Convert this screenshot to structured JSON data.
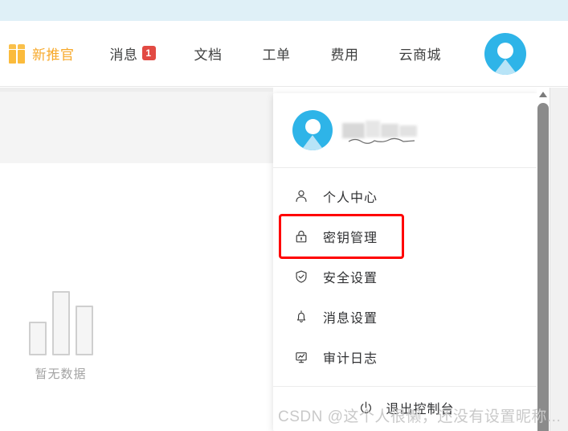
{
  "header": {
    "promo": {
      "icon": "gift-icon",
      "label": "新推官"
    },
    "nav_items": [
      {
        "label": "消息",
        "badge": "1",
        "icon": null
      },
      {
        "label": "文档",
        "badge": null,
        "icon": null
      },
      {
        "label": "工单",
        "badge": null,
        "icon": null
      },
      {
        "label": "费用",
        "badge": null,
        "icon": null
      },
      {
        "label": "云商城",
        "badge": null,
        "icon": null
      }
    ],
    "avatar": {
      "icon": "user-avatar-icon"
    }
  },
  "main": {
    "empty_state": {
      "icon": "empty-bar-chart-icon",
      "text": "暂无数据"
    }
  },
  "dropdown": {
    "user": {
      "avatar_icon": "user-avatar-icon",
      "username": ""
    },
    "items": [
      {
        "icon": "user-icon",
        "label": "个人中心",
        "highlighted": false
      },
      {
        "icon": "lock-icon",
        "label": "密钥管理",
        "highlighted": true
      },
      {
        "icon": "shield-icon",
        "label": "安全设置",
        "highlighted": false
      },
      {
        "icon": "bell-icon",
        "label": "消息设置",
        "highlighted": false
      },
      {
        "icon": "audit-log-icon",
        "label": "审计日志",
        "highlighted": false
      }
    ],
    "logout": {
      "icon": "power-icon",
      "label": "退出控制台"
    },
    "highlight_color": "#ff0000"
  },
  "scrollbar": {
    "up_arrow_icon": "chevron-up-icon",
    "position": "top"
  },
  "watermark": {
    "text": "CSDN @这个人很懒，还没有设置昵称..."
  },
  "colors": {
    "accent_blue": "#2eb4e8",
    "promo_orange": "#f7a92b",
    "badge_red": "#e24a43",
    "highlight_red": "#ff0000",
    "top_strip": "#dff0f7"
  }
}
